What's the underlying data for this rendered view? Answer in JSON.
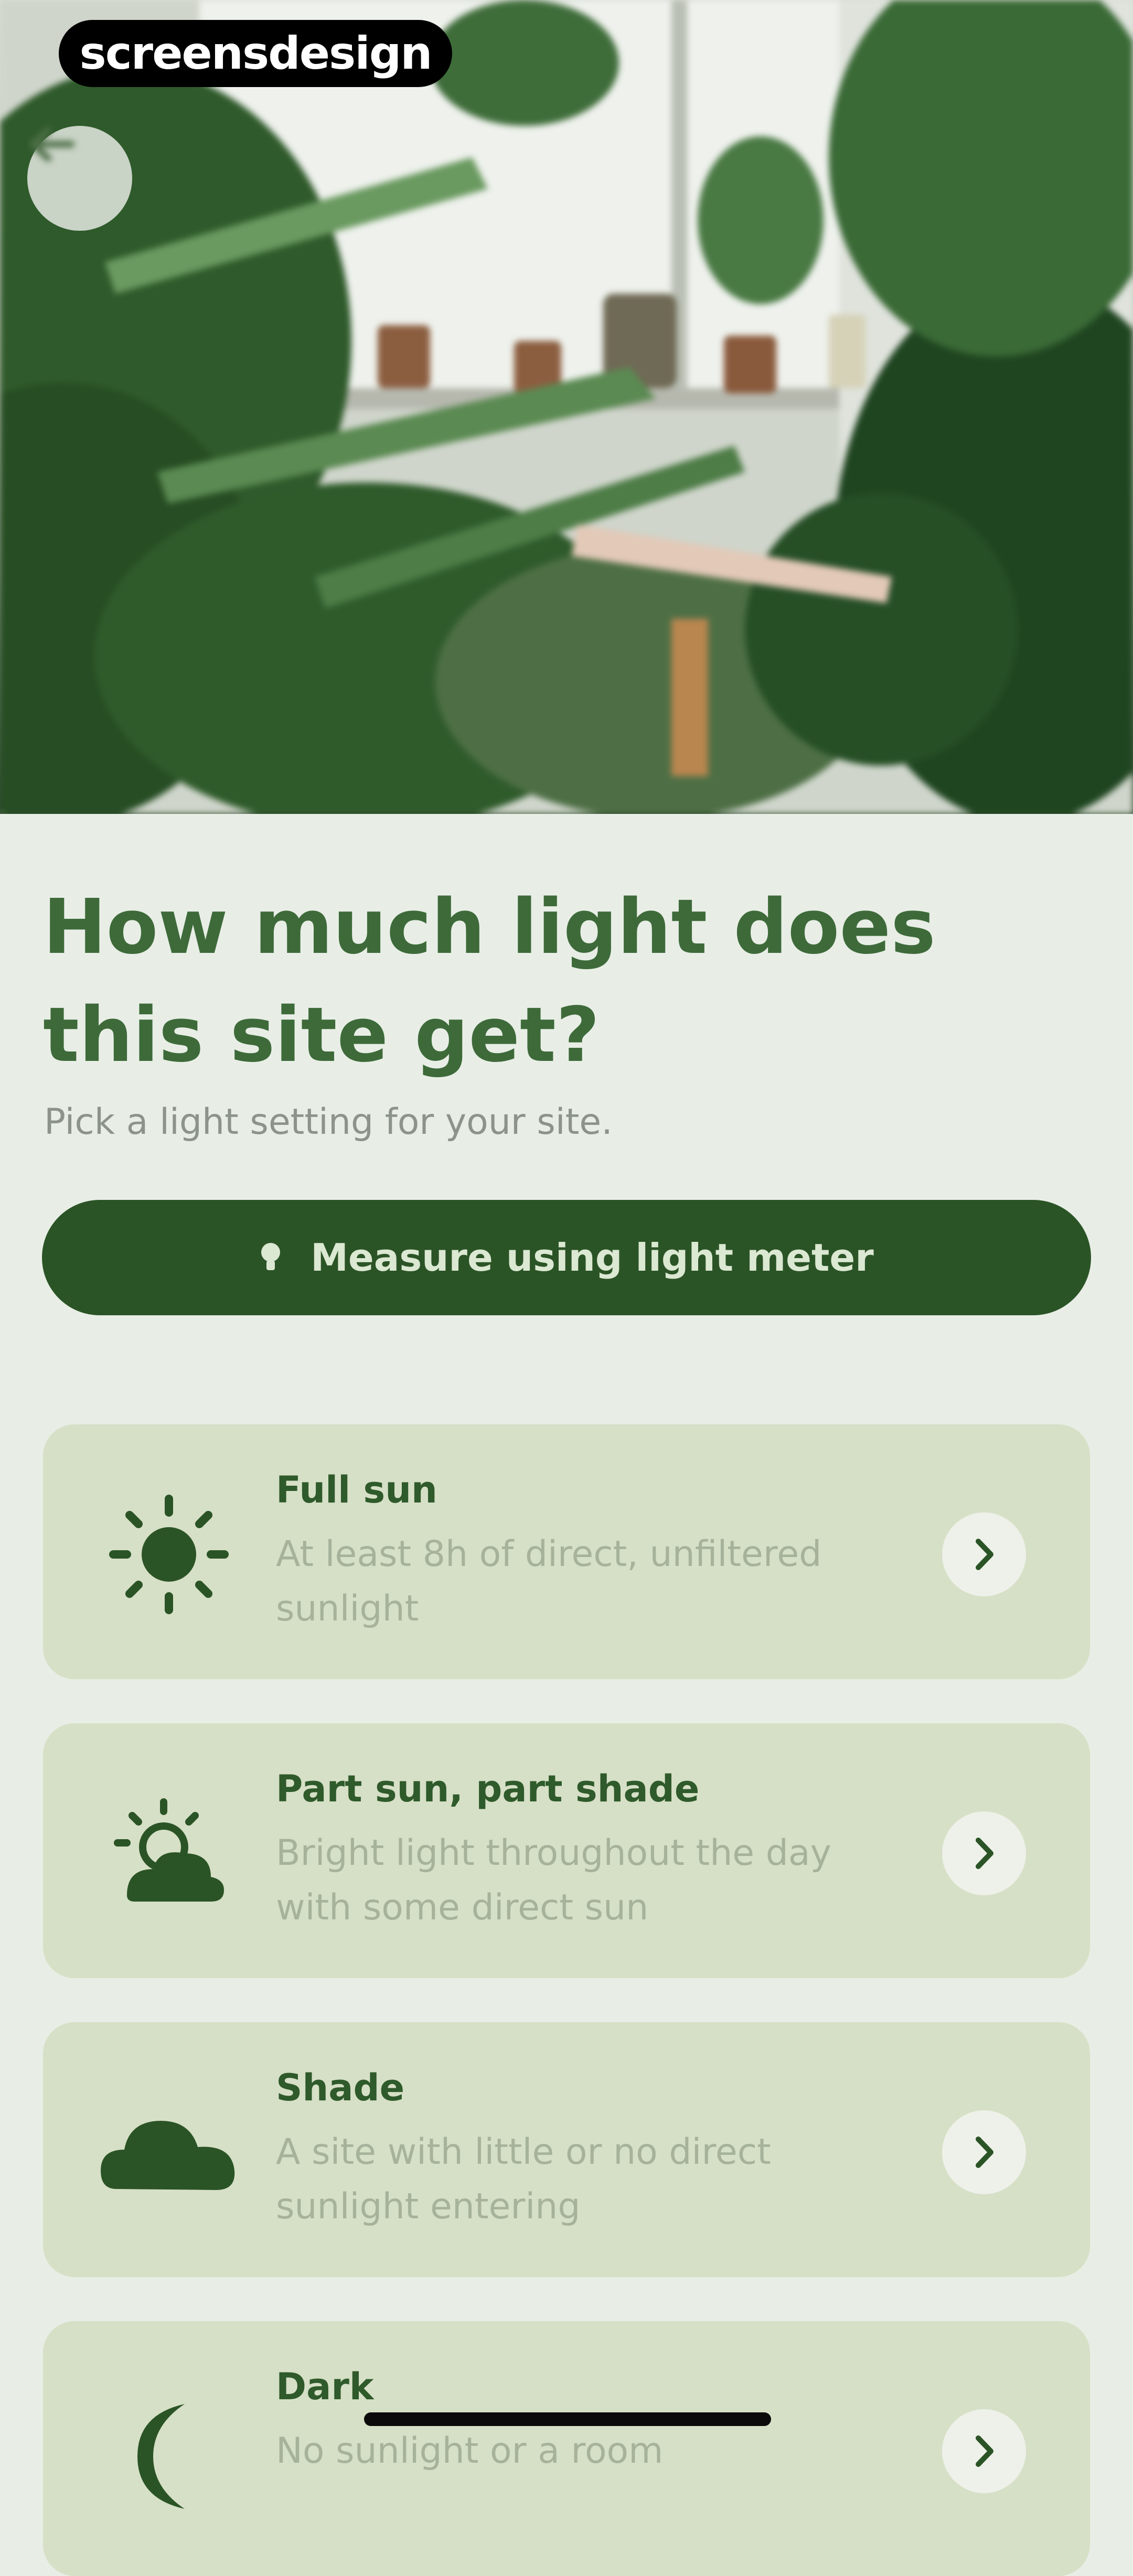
{
  "watermark": "screensdesign",
  "hero": {
    "image": "houseplants-window-photo"
  },
  "back_icon": "arrow-left-icon",
  "heading": {
    "title": "How much light does this site get?",
    "subtitle": "Pick a light setting for your site."
  },
  "meter_button": {
    "label": "Measure using light meter",
    "icon": "light-bulb-icon"
  },
  "options": [
    {
      "icon": "sun-icon",
      "name": "Full sun",
      "desc": "At least 8h of direct, unfiltered sunlight"
    },
    {
      "icon": "partly-cloudy-icon",
      "name": "Part sun, part shade",
      "desc": "Bright light throughout the day with some direct sun"
    },
    {
      "icon": "cloud-icon",
      "name": "Shade",
      "desc": "A site with little or no direct sunlight entering"
    },
    {
      "icon": "moon-icon",
      "name": "Dark",
      "desc": "No sunlight or a room"
    }
  ],
  "colors": {
    "background": "#e8eee6",
    "primary": "#2b5426",
    "card": "#d6e0c6",
    "title": "#3e6a3a"
  }
}
